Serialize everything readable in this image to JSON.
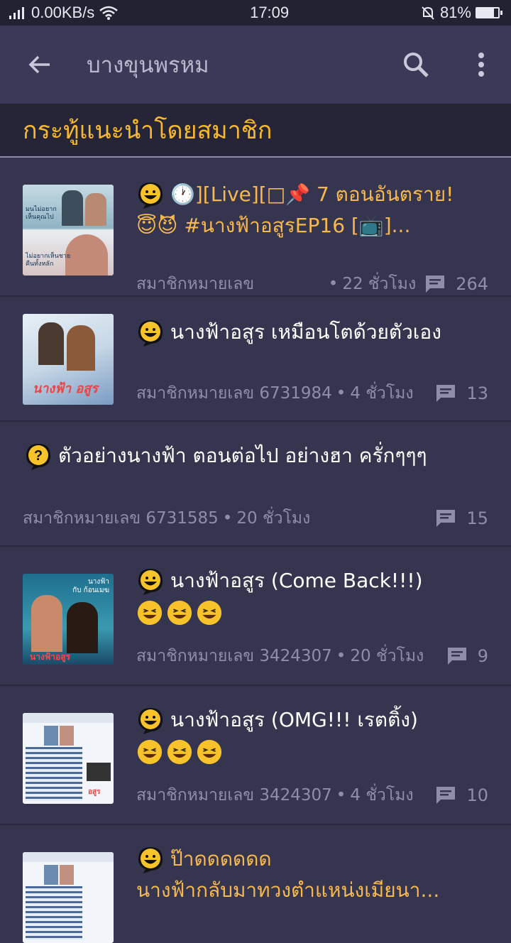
{
  "status_bar": {
    "net_speed": "0.00KB/s",
    "time": "17:09",
    "battery": "81%",
    "battery_level": 0.81
  },
  "app_bar": {
    "title": "บางขุนพรหม"
  },
  "section": {
    "title": "กระทู้แนะนำโดยสมาชิก"
  },
  "posts": [
    {
      "title_line1": "🕐][Live][",
      "title_line1b": "📌 7 ตอนอันตราย!",
      "title_line2": "#นางฟ้าอสูรEP16 [",
      "title_line2b": "]...",
      "author": "สมาชิกหมายเลข",
      "time": "22 ชั่วโมง",
      "comments": "264"
    },
    {
      "title": "นางฟ้าอสูร เหมือนโตด้วยตัวเอง",
      "author": "สมาชิกหมายเลข 6731984",
      "time": "4 ชั่วโมง",
      "comments": "13"
    },
    {
      "title": "ตัวอย่างนางฟ้า ตอนต่อไป อย่างฮา ครั่กๆๆๆ",
      "author": "สมาชิกหมายเลข 6731585",
      "time": "20 ชั่วโมง",
      "comments": "15"
    },
    {
      "title": "นางฟ้าอสูร (Come Back!!!)",
      "author": "สมาชิกหมายเลข 3424307",
      "time": "20 ชั่วโมง",
      "comments": "9"
    },
    {
      "title": "นางฟ้าอสูร (OMG!!! เรตติ้ง)",
      "author": "สมาชิกหมายเลข 3424307",
      "time": "4 ชั่วโมง",
      "comments": "10"
    },
    {
      "title_line1": "ป๊าดดดดดด",
      "title_line2": "นางฟ้ากลับมาทวงตำแหน่งเมียนา..."
    }
  ],
  "colors": {
    "accent": "#f5b82e",
    "background": "#36354f",
    "appbar": "#3a3957"
  }
}
